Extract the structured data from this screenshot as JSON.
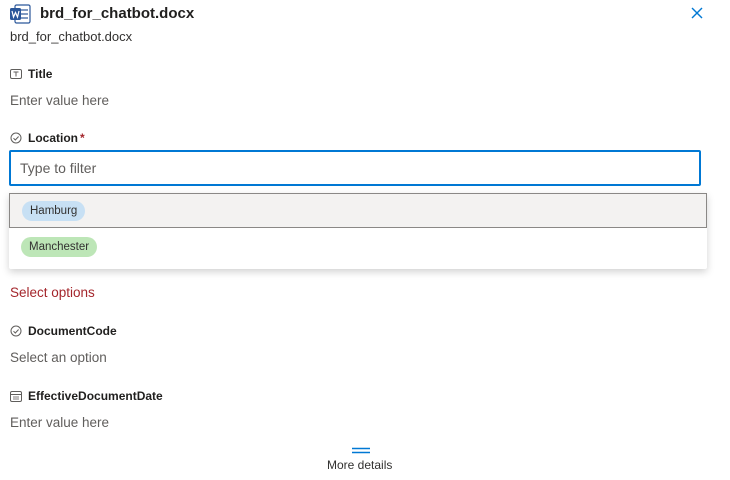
{
  "header": {
    "title": "brd_for_chatbot.docx",
    "subtitle": "brd_for_chatbot.docx",
    "file_icon": "word-doc-icon",
    "close_icon": "close-icon"
  },
  "fields": {
    "title": {
      "label": "Title",
      "placeholder": "Enter value here"
    },
    "location": {
      "label": "Location",
      "required_mark": "*",
      "filter_placeholder": "Type to filter",
      "options": [
        "Hamburg",
        "Manchester"
      ]
    },
    "hidden_field": {
      "placeholder": "Select options"
    },
    "document_code": {
      "label": "DocumentCode",
      "placeholder": "Select an option"
    },
    "effective_date": {
      "label": "EffectiveDocumentDate",
      "placeholder": "Enter value here"
    }
  },
  "footer": {
    "more_details": "More details"
  },
  "colors": {
    "accent": "#0078d4",
    "required": "#a4262c",
    "chip_hamburg": "#c7e0f4",
    "chip_manchester": "#bde6b7"
  }
}
